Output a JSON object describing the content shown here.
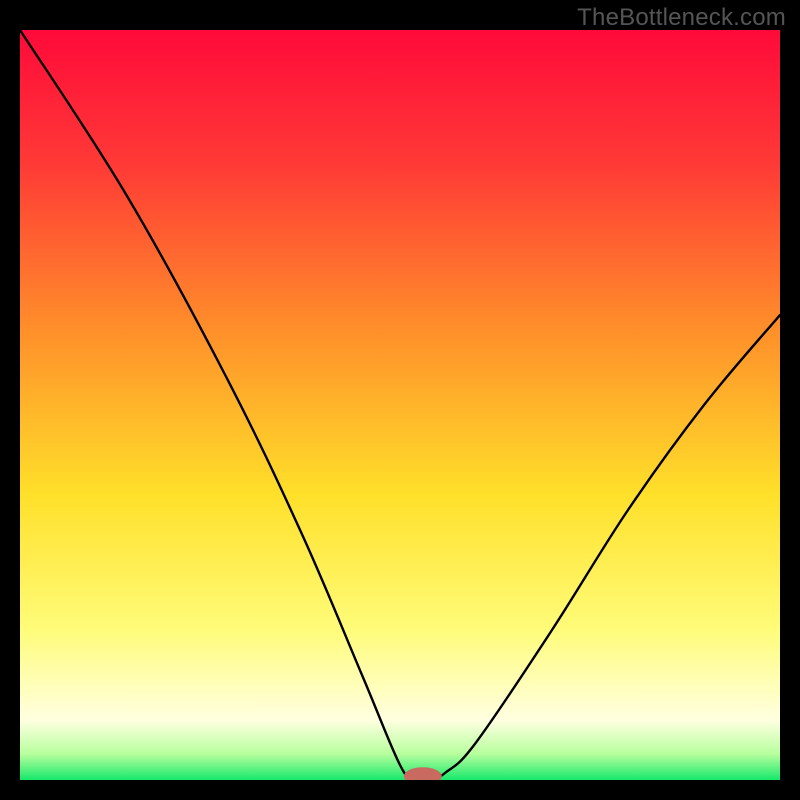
{
  "watermark": "TheBottleneck.com",
  "chart_data": {
    "type": "line",
    "title": "",
    "xlabel": "",
    "ylabel": "",
    "xlim": [
      0,
      100
    ],
    "ylim": [
      0,
      100
    ],
    "gradient_stops": [
      {
        "offset": 0.0,
        "color": "#ff0a3a"
      },
      {
        "offset": 0.18,
        "color": "#ff3a36"
      },
      {
        "offset": 0.4,
        "color": "#ff8f2a"
      },
      {
        "offset": 0.62,
        "color": "#ffe02a"
      },
      {
        "offset": 0.8,
        "color": "#fffc7a"
      },
      {
        "offset": 0.92,
        "color": "#ffffe0"
      },
      {
        "offset": 0.965,
        "color": "#b8ff9e"
      },
      {
        "offset": 1.0,
        "color": "#17e86b"
      }
    ],
    "curve": [
      {
        "x": 0,
        "y": 100
      },
      {
        "x": 14,
        "y": 78
      },
      {
        "x": 27,
        "y": 54
      },
      {
        "x": 37,
        "y": 33
      },
      {
        "x": 45,
        "y": 14
      },
      {
        "x": 50,
        "y": 2
      },
      {
        "x": 52,
        "y": 0
      },
      {
        "x": 54,
        "y": 0
      },
      {
        "x": 56,
        "y": 1
      },
      {
        "x": 60,
        "y": 5
      },
      {
        "x": 70,
        "y": 20
      },
      {
        "x": 80,
        "y": 36
      },
      {
        "x": 90,
        "y": 50
      },
      {
        "x": 100,
        "y": 62
      }
    ],
    "marker": {
      "x": 53,
      "y": 0.5,
      "color": "#c96a60",
      "rx": 2.5,
      "ry": 1.2
    }
  }
}
